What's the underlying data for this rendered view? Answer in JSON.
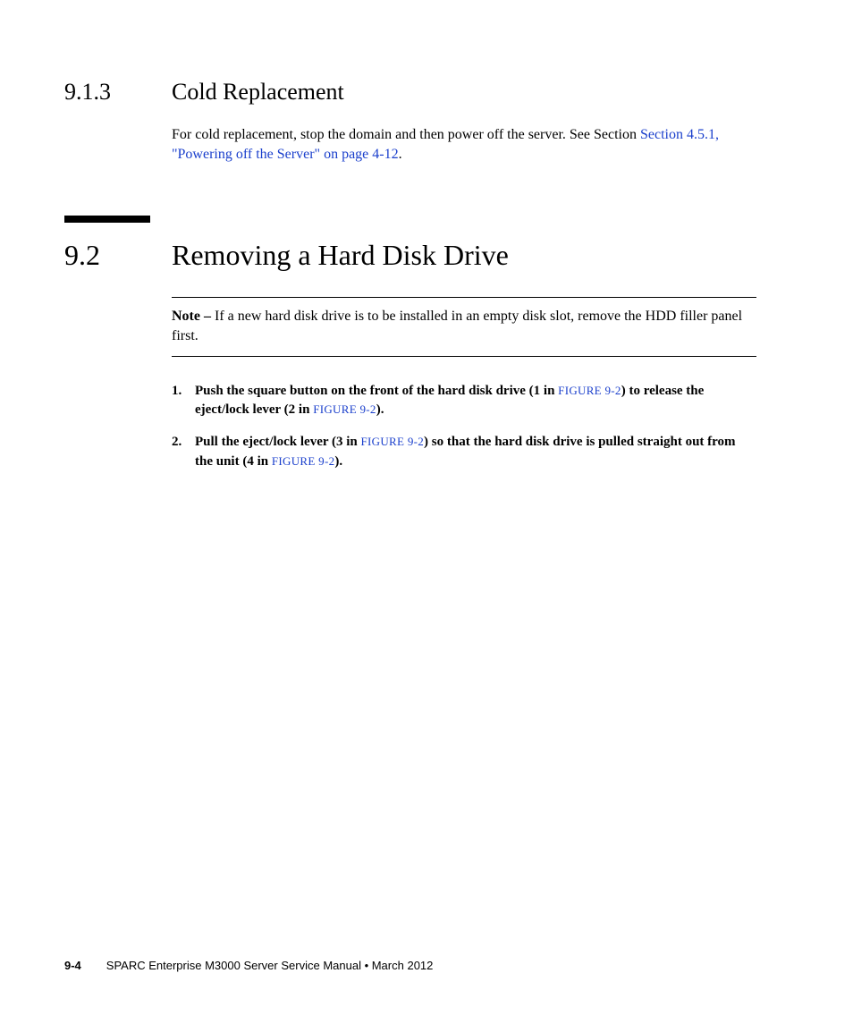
{
  "section913": {
    "number": "9.1.3",
    "title": "Cold Replacement",
    "para_prefix": "For cold replacement, stop the domain and then power off the server. See Section ",
    "link_text": "Section 4.5.1, \"Powering off the Server\" on page 4-12",
    "para_suffix": "."
  },
  "section92": {
    "number": "9.2",
    "title": "Removing a Hard Disk Drive"
  },
  "note": {
    "label": "Note – ",
    "text": "If a new hard disk drive is to be installed in an empty disk slot, remove the HDD filler panel first."
  },
  "steps": {
    "step1": {
      "num": "1.",
      "t1": "Push the square button on the front of the hard disk drive (1 in ",
      "fig1": "FIGURE 9-2",
      "t2": ") to release the eject/lock lever (2 in ",
      "fig2": "FIGURE 9-2",
      "t3": ")."
    },
    "step2": {
      "num": "2.",
      "t1": "Pull the eject/lock lever (3 in ",
      "fig1": "FIGURE 9-2",
      "t2": ") so that the hard disk drive is pulled straight out from the unit (4 in ",
      "fig2": "FIGURE 9-2",
      "t3": ")."
    }
  },
  "footer": {
    "pagenum": "9-4",
    "text": "SPARC Enterprise M3000 Server Service Manual • March 2012"
  }
}
